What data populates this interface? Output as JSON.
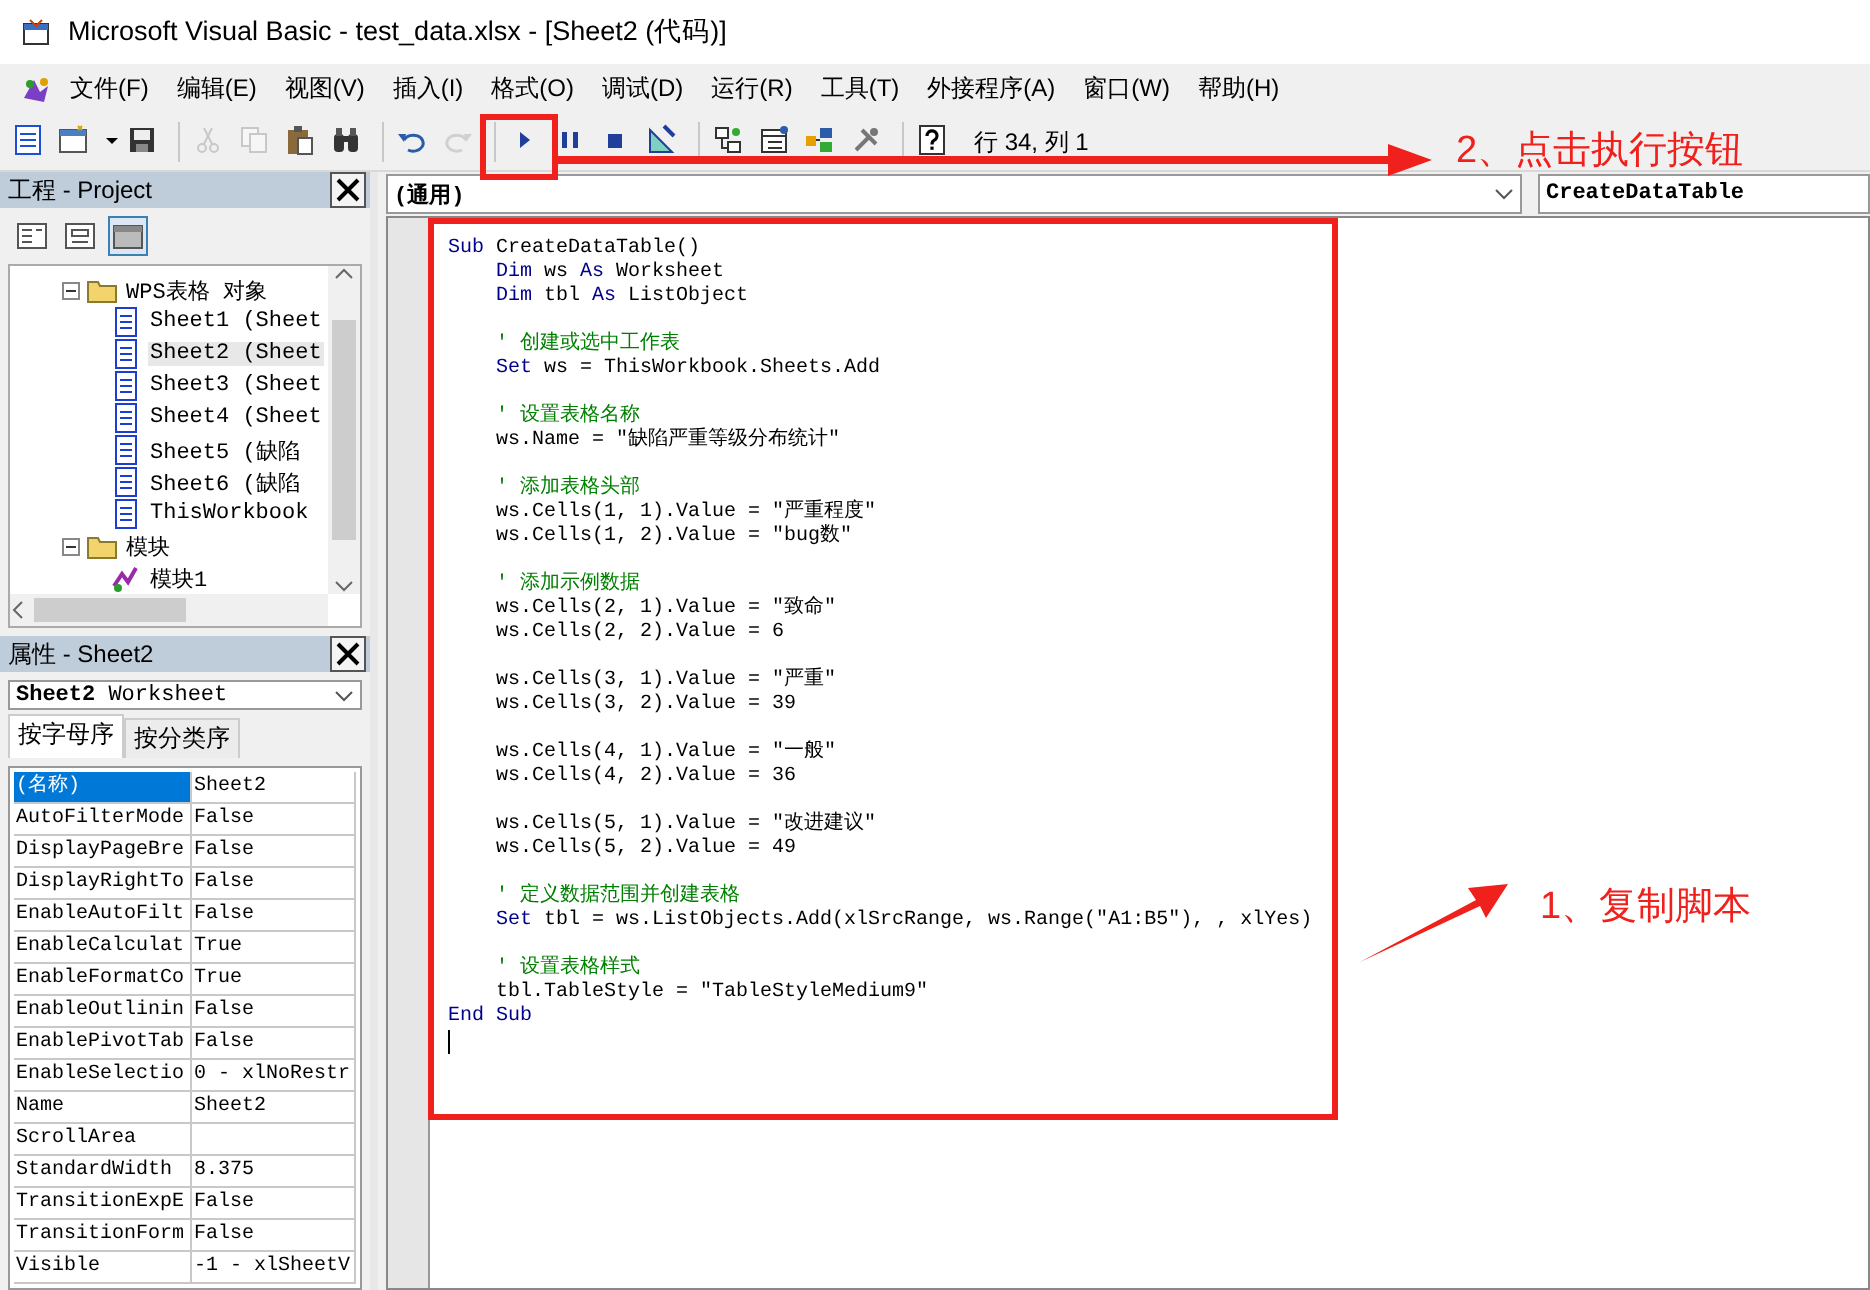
{
  "window": {
    "title": "Microsoft Visual Basic - test_data.xlsx - [Sheet2 (代码)]"
  },
  "menu": [
    "文件(F)",
    "编辑(E)",
    "视图(V)",
    "插入(I)",
    "格式(O)",
    "调试(D)",
    "运行(R)",
    "工具(T)",
    "外接程序(A)",
    "窗口(W)",
    "帮助(H)"
  ],
  "toolbar": {
    "buttons": [
      {
        "kind": "document",
        "disabled": false
      },
      {
        "kind": "form",
        "disabled": false
      },
      {
        "kind": "caret",
        "disabled": false
      },
      {
        "kind": "save",
        "disabled": false
      },
      {
        "kind": "separator"
      },
      {
        "kind": "scissors",
        "disabled": true
      },
      {
        "kind": "copy",
        "disabled": true
      },
      {
        "kind": "paste",
        "disabled": false
      },
      {
        "kind": "binoculars",
        "disabled": false
      },
      {
        "kind": "separator"
      },
      {
        "kind": "undo",
        "disabled": false
      },
      {
        "kind": "redo",
        "disabled": true
      },
      {
        "kind": "separator"
      },
      {
        "kind": "play",
        "disabled": false
      },
      {
        "kind": "pause",
        "disabled": false
      },
      {
        "kind": "stop",
        "disabled": false
      },
      {
        "kind": "ruler",
        "disabled": false
      },
      {
        "kind": "separator"
      },
      {
        "kind": "project",
        "disabled": false
      },
      {
        "kind": "properties",
        "disabled": false
      },
      {
        "kind": "browser",
        "disabled": false
      },
      {
        "kind": "toolbox",
        "disabled": false
      },
      {
        "kind": "separator"
      },
      {
        "kind": "help",
        "disabled": false
      }
    ],
    "position": "行 34, 列 1"
  },
  "project": {
    "title": "工程 - Project",
    "buttons": [
      {
        "kind": "code",
        "selected": false
      },
      {
        "kind": "object",
        "selected": false
      },
      {
        "kind": "folders",
        "selected": true
      }
    ],
    "tree": [
      {
        "label": "WPS表格 对象",
        "kind": "folder",
        "expanded": true,
        "children": [
          {
            "label": "Sheet1 (Sheet",
            "kind": "sheet",
            "selected": false
          },
          {
            "label": "Sheet2 (Sheet",
            "kind": "sheet",
            "selected": true
          },
          {
            "label": "Sheet3 (Sheet",
            "kind": "sheet",
            "selected": false
          },
          {
            "label": "Sheet4 (Sheet",
            "kind": "sheet",
            "selected": false
          },
          {
            "label": "Sheet5 (缺陷",
            "kind": "sheet",
            "selected": false
          },
          {
            "label": "Sheet6 (缺陷",
            "kind": "sheet",
            "selected": false
          },
          {
            "label": "ThisWorkbook",
            "kind": "sheet",
            "selected": false
          }
        ]
      },
      {
        "label": "模块",
        "kind": "folder",
        "expanded": true,
        "children": [
          {
            "label": "模块1",
            "kind": "module",
            "selected": false
          }
        ]
      }
    ]
  },
  "properties": {
    "title": "属性 - Sheet2",
    "object": "**Sheet2** Worksheet",
    "tabs": [
      {
        "label": "按字母序",
        "selected": true
      },
      {
        "label": "按分类序",
        "selected": false
      }
    ],
    "rows": [
      {
        "name": "(名称)",
        "value": "Sheet2",
        "selected": true
      },
      {
        "name": "AutoFilterMode",
        "value": "False",
        "selected": false
      },
      {
        "name": "DisplayPageBre",
        "value": "False",
        "selected": false
      },
      {
        "name": "DisplayRightTo",
        "value": "False",
        "selected": false
      },
      {
        "name": "EnableAutoFilt",
        "value": "False",
        "selected": false
      },
      {
        "name": "EnableCalculat",
        "value": "True",
        "selected": false
      },
      {
        "name": "EnableFormatCo",
        "value": "True",
        "selected": false
      },
      {
        "name": "EnableOutlinin",
        "value": "False",
        "selected": false
      },
      {
        "name": "EnablePivotTab",
        "value": "False",
        "selected": false
      },
      {
        "name": "EnableSelectio",
        "value": "0 - xlNoRestr",
        "selected": false
      },
      {
        "name": "Name",
        "value": "Sheet2",
        "selected": false
      },
      {
        "name": "ScrollArea",
        "selected": false
      },
      {
        "name": "StandardWidth",
        "value": "8.375",
        "selected": false
      },
      {
        "name": "TransitionExpE",
        "value": "False",
        "selected": false
      },
      {
        "name": "TransitionForm",
        "value": "False",
        "selected": false
      },
      {
        "name": "Visible",
        "value": "-1 - xlSheetV",
        "selected": false
      }
    ]
  },
  "editor": {
    "object_combo": "(通用)",
    "procedure_combo": "CreateDataTable",
    "lines": [
      {
        "kind": "code",
        "indented": false,
        "segments": [
          {
            "kind": "keyword",
            "text": "Sub"
          },
          {
            "kind": "plain",
            "text": " CreateDataTable()"
          }
        ]
      },
      {
        "kind": "code",
        "indented": true,
        "segments": [
          {
            "kind": "keyword",
            "text": "Dim"
          },
          {
            "kind": "plain",
            "text": " ws "
          },
          {
            "kind": "keyword",
            "text": "As"
          },
          {
            "kind": "plain",
            "text": " Worksheet"
          }
        ]
      },
      {
        "kind": "code",
        "indented": true,
        "segments": [
          {
            "kind": "keyword",
            "text": "Dim"
          },
          {
            "kind": "plain",
            "text": " tbl "
          },
          {
            "kind": "keyword",
            "text": "As"
          },
          {
            "kind": "plain",
            "text": " ListObject"
          }
        ]
      },
      {
        "kind": "blank"
      },
      {
        "kind": "code",
        "indented": true,
        "segments": [
          {
            "kind": "comment",
            "text": "' 创建或选中工作表"
          }
        ]
      },
      {
        "kind": "code",
        "indented": true,
        "segments": [
          {
            "kind": "keyword",
            "text": "Set"
          },
          {
            "kind": "plain",
            "text": " ws = ThisWorkbook.Sheets.Add"
          }
        ]
      },
      {
        "kind": "blank"
      },
      {
        "kind": "code",
        "indented": true,
        "segments": [
          {
            "kind": "comment",
            "text": "' 设置表格名称"
          }
        ]
      },
      {
        "kind": "code",
        "indented": true,
        "segments": [
          {
            "kind": "plain",
            "text": "ws.Name = \"缺陷严重等级分布统计\""
          }
        ]
      },
      {
        "kind": "blank"
      },
      {
        "kind": "code",
        "indented": true,
        "segments": [
          {
            "kind": "comment",
            "text": "' 添加表格头部"
          }
        ]
      },
      {
        "kind": "code",
        "indented": true,
        "segments": [
          {
            "kind": "plain",
            "text": "ws.Cells(1, 1).Value = \"严重程度\""
          }
        ]
      },
      {
        "kind": "code",
        "indented": true,
        "segments": [
          {
            "kind": "plain",
            "text": "ws.Cells(1, 2).Value = \"bug数\""
          }
        ]
      },
      {
        "kind": "blank"
      },
      {
        "kind": "code",
        "indented": true,
        "segments": [
          {
            "kind": "comment",
            "text": "' 添加示例数据"
          }
        ]
      },
      {
        "kind": "code",
        "indented": true,
        "segments": [
          {
            "kind": "plain",
            "text": "ws.Cells(2, 1).Value = \"致命\""
          }
        ]
      },
      {
        "kind": "code",
        "indented": true,
        "segments": [
          {
            "kind": "plain",
            "text": "ws.Cells(2, 2).Value = 6"
          }
        ]
      },
      {
        "kind": "blank"
      },
      {
        "kind": "code",
        "indented": true,
        "segments": [
          {
            "kind": "plain",
            "text": "ws.Cells(3, 1).Value = \"严重\""
          }
        ]
      },
      {
        "kind": "code",
        "indented": true,
        "segments": [
          {
            "kind": "plain",
            "text": "ws.Cells(3, 2).Value = 39"
          }
        ]
      },
      {
        "kind": "blank"
      },
      {
        "kind": "code",
        "indented": true,
        "segments": [
          {
            "kind": "plain",
            "text": "ws.Cells(4, 1).Value = \"一般\""
          }
        ]
      },
      {
        "kind": "code",
        "indented": true,
        "segments": [
          {
            "kind": "plain",
            "text": "ws.Cells(4, 2).Value = 36"
          }
        ]
      },
      {
        "kind": "blank"
      },
      {
        "kind": "code",
        "indented": true,
        "segments": [
          {
            "kind": "plain",
            "text": "ws.Cells(5, 1).Value = \"改进建议\""
          }
        ]
      },
      {
        "kind": "code",
        "indented": true,
        "segments": [
          {
            "kind": "plain",
            "text": "ws.Cells(5, 2).Value = 49"
          }
        ]
      },
      {
        "kind": "blank"
      },
      {
        "kind": "code",
        "indented": true,
        "segments": [
          {
            "kind": "comment",
            "text": "' 定义数据范围并创建表格"
          }
        ]
      },
      {
        "kind": "code",
        "indented": true,
        "segments": [
          {
            "kind": "keyword",
            "text": "Set"
          },
          {
            "kind": "plain",
            "text": " tbl = ws.ListObjects.Add(xlSrcRange, ws.Range(\"A1:B5\"), , xlYes)"
          }
        ]
      },
      {
        "kind": "blank"
      },
      {
        "kind": "code",
        "indented": true,
        "segments": [
          {
            "kind": "comment",
            "text": "' 设置表格样式"
          }
        ]
      },
      {
        "kind": "code",
        "indented": true,
        "segments": [
          {
            "kind": "plain",
            "text": "tbl.TableStyle = \"TableStyleMedium9\""
          }
        ]
      },
      {
        "kind": "code",
        "indented": false,
        "segments": [
          {
            "kind": "keyword",
            "text": "End Sub"
          }
        ]
      },
      {
        "kind": "cursor"
      }
    ]
  },
  "annotations": [
    {
      "text": "2、点击执行按钮"
    },
    {
      "text": "1、复制脚本"
    }
  ]
}
